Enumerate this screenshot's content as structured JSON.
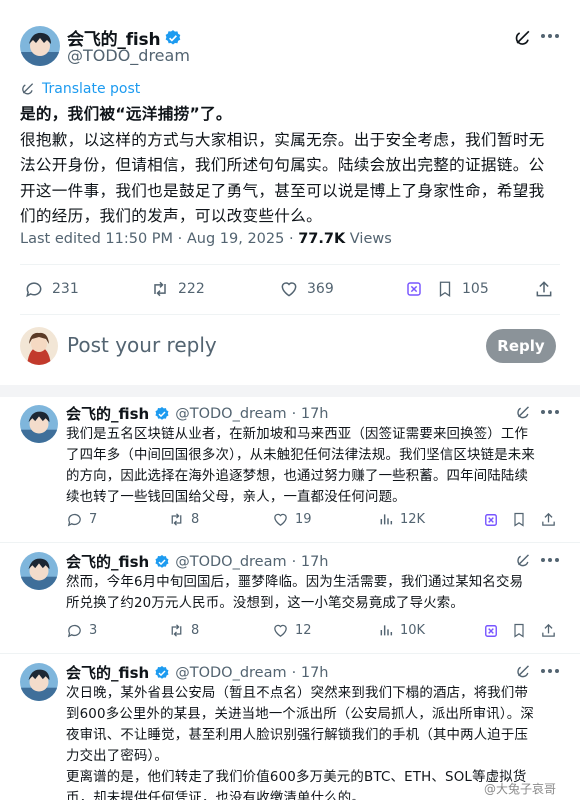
{
  "post": {
    "author_name": "会飞的_fish",
    "handle": "@TODO_dream",
    "translate_label": "Translate post",
    "text_lines": [
      "是的，我们被“远洋捕捞”了。",
      "很抱歉，以这样的方式与大家相识，实属无奈。出于安全考虑，我们暂时无",
      "法公开身份，但请相信，我们所述句句属实。陆续会放出完整的证据链。公",
      "开这一件事，我们也是鼓足了勇气，甚至可以说是博上了身家性命，希望我",
      "们的经历，我们的发声，可以改变些什么。"
    ],
    "edited_label": "Last edited 11:50 PM · Aug 19, 2025 · ",
    "views_count": "77.7K",
    "views_label": " Views",
    "stats": {
      "replies": "231",
      "reposts": "222",
      "likes": "369",
      "bookmarks": "105"
    }
  },
  "reply_box": {
    "placeholder": "Post your reply",
    "button_label": "Reply"
  },
  "replies": [
    {
      "author_name": "会飞的_fish",
      "handle": "@TODO_dream",
      "time": "· 17h",
      "text_lines": [
        "我们是五名区块链从业者，在新加坡和马来西亚（因签证需要来回换签）工作",
        "了四年多（中间回国很多次），从未触犯任何法律法规。我们坚信区块链是未来",
        "的方向，因此选择在海外追逐梦想，也通过努力赚了一些积蓄。四年间陆陆续",
        "续也转了一些钱回国给父母，亲人，一直都没任何问题。"
      ],
      "stats": {
        "replies": "7",
        "reposts": "8",
        "likes": "19",
        "views": "12K"
      }
    },
    {
      "author_name": "会飞的_fish",
      "handle": "@TODO_dream",
      "time": "· 17h",
      "text_lines": [
        "然而，今年6月中旬回国后，噩梦降临。因为生活需要，我们通过某知名交易",
        "所兑换了约20万元人民币。没想到，这一小笔交易竟成了导火索。"
      ],
      "stats": {
        "replies": "3",
        "reposts": "8",
        "likes": "12",
        "views": "10K"
      }
    },
    {
      "author_name": "会飞的_fish",
      "handle": "@TODO_dream",
      "time": "· 17h",
      "text_lines": [
        "次日晚，某外省县公安局（暂且不点名）突然来到我们下榻的酒店，将我们带",
        "到600多公里外的某县，关进当地一个派出所（公安局抓人，派出所审讯）。深",
        "夜审讯、不让睡觉，甚至利用人脸识别强行解锁我们的手机（其中两人迫于压",
        "力交出了密码）。",
        "更离谱的是，他们转走了我们价值600多万美元的BTC、ETH、SOL等虚拟货",
        "币，却未提供任何凭证，也没有收缴清单什么的。"
      ]
    }
  ],
  "watermark": "@大兔子哀哥",
  "colors": {
    "verified": "#1d9bf0",
    "accent": "#1d9bf0",
    "grok_purple": "#7856ff",
    "text": "#0f1419",
    "muted": "#536471"
  }
}
